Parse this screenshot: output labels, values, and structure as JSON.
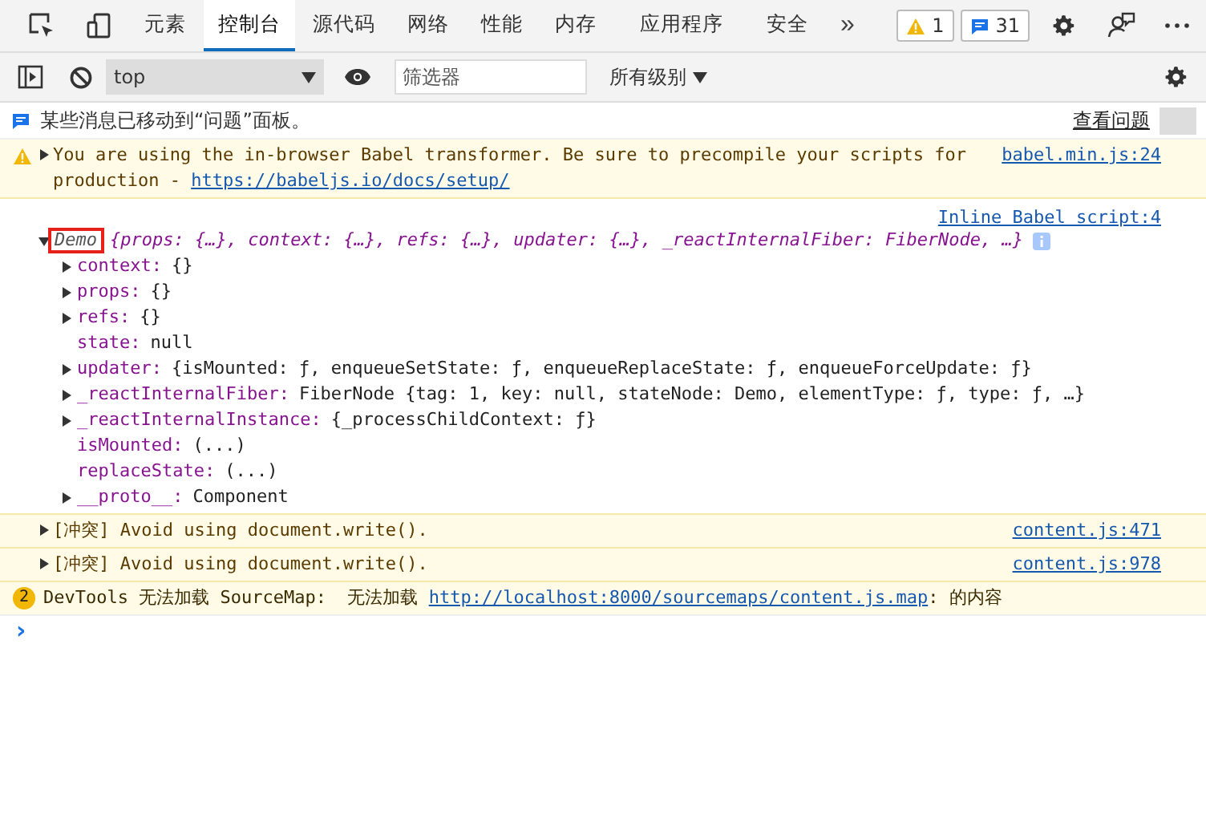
{
  "tabs": [
    {
      "label": "元素",
      "selected": false
    },
    {
      "label": "控制台",
      "selected": true
    },
    {
      "label": "源代码",
      "selected": false
    },
    {
      "label": "网络",
      "selected": false
    },
    {
      "label": "性能",
      "selected": false
    },
    {
      "label": "内存",
      "selected": false
    },
    {
      "label": "应用程序",
      "selected": false
    },
    {
      "label": "安全",
      "selected": false
    }
  ],
  "more_tabs": "»",
  "badges": [
    {
      "kind": "warning",
      "count": "1"
    },
    {
      "kind": "message",
      "count": "31"
    }
  ],
  "console_toolbar": {
    "context": "top",
    "filter": {
      "placeholder": "筛选器"
    },
    "levels": "所有级别"
  },
  "notice": {
    "text": "某些消息已移动到“问题”面板。",
    "button": "查看问题"
  },
  "messages": [
    {
      "kind": "warning",
      "expandable": true,
      "text": "You are using the in-browser Babel transformer. Be sure to precompile your scripts for production - ",
      "link": "https://babeljs.io/docs/setup/",
      "source": "babel.min.js:24"
    },
    {
      "kind": "object",
      "source": "Inline Babel script:4",
      "name": "Demo",
      "highlighted": true,
      "expanded": true,
      "summary": "{props: {…}, context: {…}, refs: {…}, updater: {…}, _reactInternalFiber: FiberNode, …}",
      "properties": [
        {
          "key": "context:",
          "value": "{}",
          "expandable": true
        },
        {
          "key": "props:",
          "value": "{}",
          "expandable": true
        },
        {
          "key": "refs:",
          "value": "{}",
          "expandable": true
        },
        {
          "key": "state:",
          "value": "null",
          "expandable": false
        },
        {
          "key": "updater:",
          "value": "{isMounted: ƒ, enqueueSetState: ƒ, enqueueReplaceState: ƒ, enqueueForceUpdate: ƒ}",
          "expandable": true
        },
        {
          "key": "_reactInternalFiber:",
          "value": "FiberNode {tag: 1, key: null, stateNode: Demo, elementType: ƒ, type: ƒ, …}",
          "expandable": true
        },
        {
          "key": "_reactInternalInstance:",
          "value": "{_processChildContext: ƒ}",
          "expandable": true
        },
        {
          "key": "isMounted:",
          "value": "(...)",
          "expandable": false
        },
        {
          "key": "replaceState:",
          "value": "(...)",
          "expandable": false
        },
        {
          "key": "__proto__:",
          "value": "Component",
          "expandable": true
        }
      ]
    },
    {
      "kind": "warning",
      "expandable": true,
      "text": "[冲突] Avoid using document.write().",
      "source": "content.js:471"
    },
    {
      "kind": "warning",
      "expandable": true,
      "text": "[冲突] Avoid using document.write().",
      "source": "content.js:978"
    },
    {
      "kind": "grouped",
      "count": "2",
      "text": "DevTools 无法加载 SourceMap:  无法加载 ",
      "link": "http://localhost:8000/sourcemaps/content.js.map",
      "after": ": 的内容"
    }
  ],
  "prompt": "›"
}
